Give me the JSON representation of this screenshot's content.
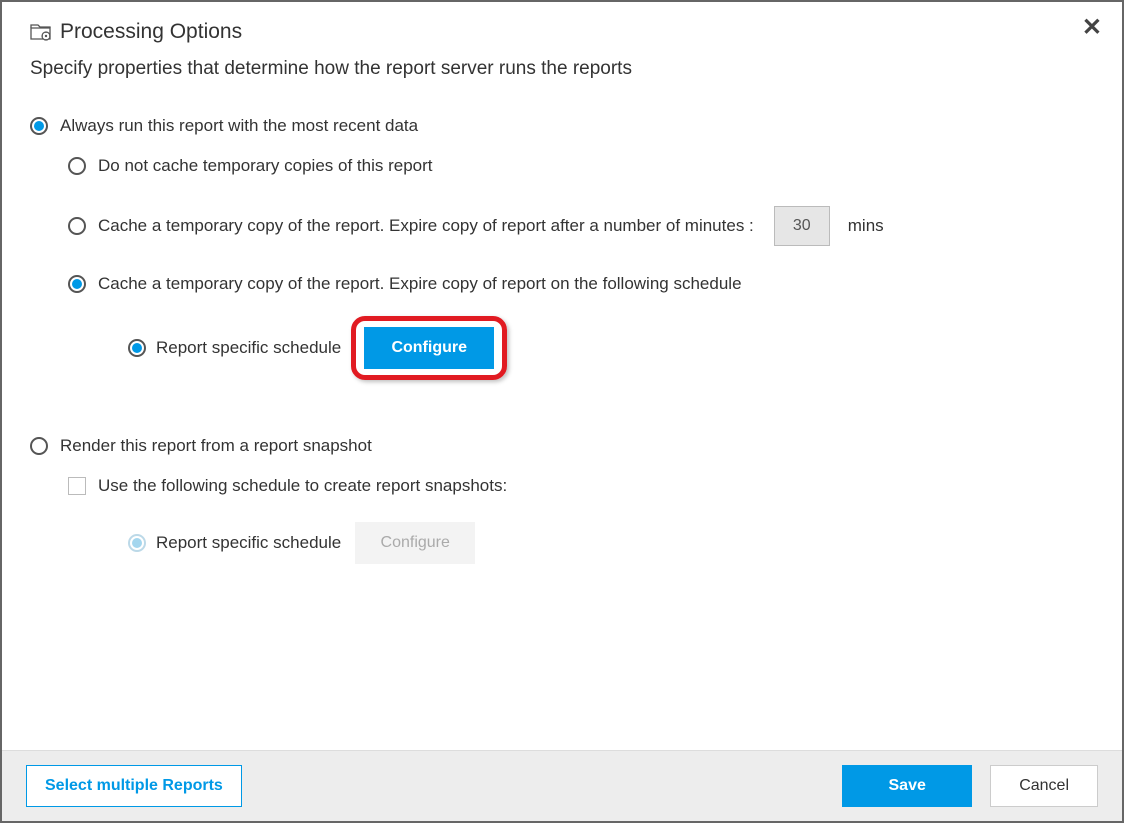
{
  "dialog": {
    "title": "Processing Options",
    "subtitle": "Specify properties that determine how the report server runs the reports"
  },
  "options": {
    "alwaysRecent": {
      "label": "Always run this report with the most recent data",
      "selected": true,
      "sub": {
        "noCache": {
          "label": "Do not cache temporary copies of this report",
          "selected": false
        },
        "cacheMinutes": {
          "label": "Cache a temporary copy of the report. Expire copy of report after a number of minutes :",
          "selected": false,
          "value": "30",
          "unit": "mins"
        },
        "cacheSchedule": {
          "label": "Cache a temporary copy of the report. Expire copy of report on the following schedule",
          "selected": true,
          "scheduleType": {
            "label": "Report specific schedule",
            "selected": true,
            "configureLabel": "Configure"
          }
        }
      }
    },
    "snapshot": {
      "label": "Render this report from a report snapshot",
      "selected": false,
      "useSchedule": {
        "label": "Use the following schedule to create report snapshots:",
        "checked": false,
        "scheduleType": {
          "label": "Report specific schedule",
          "selected": true,
          "configureLabel": "Configure"
        }
      }
    }
  },
  "footer": {
    "selectMultiple": "Select multiple Reports",
    "save": "Save",
    "cancel": "Cancel"
  }
}
